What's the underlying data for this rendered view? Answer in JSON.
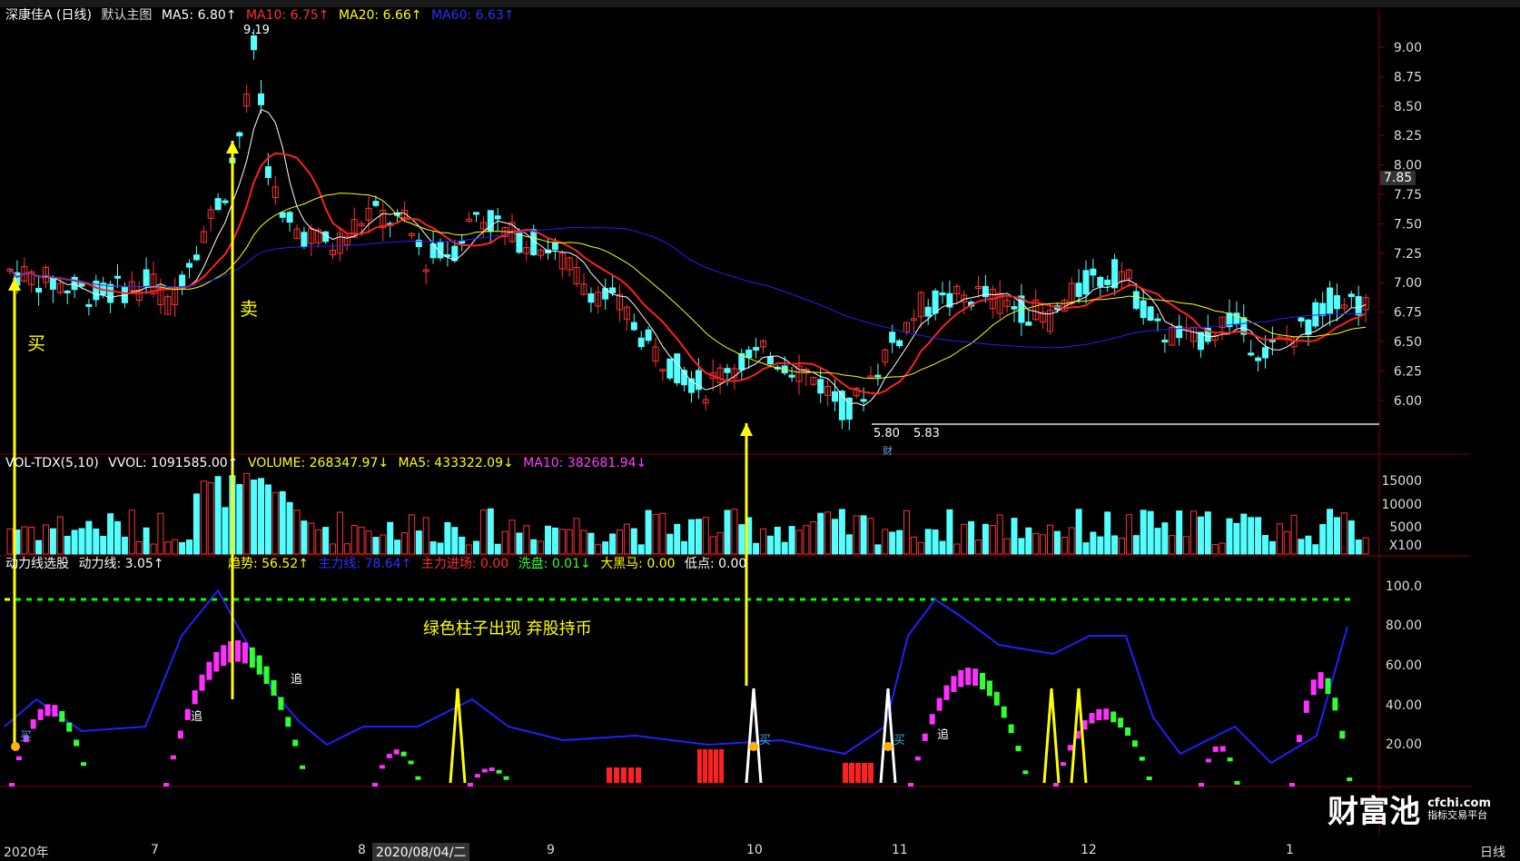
{
  "stock": {
    "name": "深康佳A (日线)",
    "main_chart": "默认主图",
    "ma5": "MA5: 6.80↑",
    "ma10": "MA10: 6.75↑",
    "ma20": "MA20: 6.66↑",
    "ma60": "MA60: 6.63↑",
    "high_label": "9.19",
    "low_label": "5.80",
    "low_label2": "5.83",
    "current_price": "7.85",
    "cai_tag": "财"
  },
  "price_axis": [
    "9.00",
    "8.75",
    "8.50",
    "8.25",
    "8.00",
    "7.75",
    "7.50",
    "7.25",
    "7.00",
    "6.75",
    "6.50",
    "6.25",
    "6.00"
  ],
  "volume": {
    "title": "VOL-TDX(5,10)",
    "vvol": "VVOL: 1091585.00↑",
    "volume": "VOLUME: 268347.97↓",
    "ma5": "MA5: 433322.09↓",
    "ma10": "MA10: 382681.94↓",
    "axis": [
      "15000",
      "10000",
      "5000",
      "X100"
    ]
  },
  "indicator": {
    "title": "动力线选股",
    "dongli": "动力线: 3.05↑",
    "qushi": "趋势: 56.52↑",
    "zhuli": "主力线: 78.64↑",
    "zhuli_entry": "主力进场: 0.00",
    "xipan": "洗盘: 0.01↓",
    "heima": "大黑马: 0.00",
    "didian": "低点: 0.00",
    "axis": [
      "100.0",
      "80.00",
      "60.00",
      "40.00",
      "20.00"
    ]
  },
  "annotations": {
    "buy": "买",
    "sell": "卖",
    "green_note": "绿色柱子出现 弃股持币",
    "zhui": "追",
    "mai": "买"
  },
  "x_axis": [
    "2020年",
    "7",
    "8",
    "2020/08/04/二",
    "9",
    "10",
    "11",
    "12",
    "1",
    "日线"
  ],
  "logo": {
    "main": "财富池",
    "site": "cfchi.com",
    "sub": "指标交易平台"
  },
  "colors": {
    "up": "#ff3232",
    "down": "#54ffff",
    "ma5": "#ffffff",
    "ma10": "#ff2020",
    "ma20": "#ffff00",
    "ma60": "#2020ff"
  }
}
